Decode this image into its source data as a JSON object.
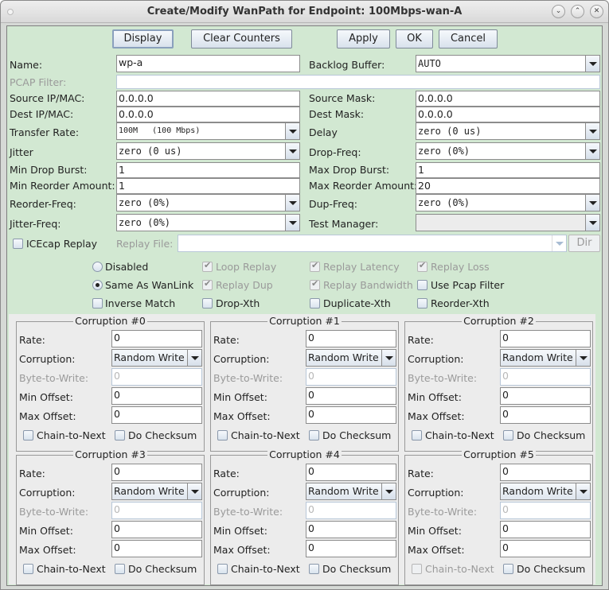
{
  "window": {
    "title": "Create/Modify WanPath for Endpoint: 100Mbps-wan-A",
    "controls": [
      "minimize",
      "maximize",
      "close"
    ]
  },
  "toolbar": {
    "display_label": "Display",
    "clear_counters_label": "Clear Counters",
    "apply_label": "Apply",
    "ok_label": "OK",
    "cancel_label": "Cancel"
  },
  "form": {
    "name_label": "Name:",
    "name_value": "wp-a",
    "backlog_label": "Backlog Buffer:",
    "backlog_value": "AUTO",
    "pcap_label": "PCAP Filter:",
    "pcap_value": "",
    "src_ip_label": "Source IP/MAC:",
    "src_ip_value": "0.0.0.0",
    "src_mask_label": "Source Mask:",
    "src_mask_value": "0.0.0.0",
    "dst_ip_label": "Dest IP/MAC:",
    "dst_ip_value": "0.0.0.0",
    "dst_mask_label": "Dest Mask:",
    "dst_mask_value": "0.0.0.0",
    "rate_label": "Transfer Rate:",
    "rate_value": "100M   (100 Mbps)",
    "delay_label": "Delay",
    "delay_value": "zero (0 us)",
    "jitter_label": "Jitter",
    "jitter_value": "zero (0 us)",
    "drop_freq_label": "Drop-Freq:",
    "drop_freq_value": "zero (0%)",
    "min_drop_label": "Min Drop Burst:",
    "min_drop_value": "1",
    "max_drop_label": "Max Drop Burst:",
    "max_drop_value": "1",
    "min_reorder_label": "Min Reorder Amount:",
    "min_reorder_value": "1",
    "max_reorder_label": "Max Reorder Amount:",
    "max_reorder_value": "20",
    "reorder_freq_label": "Reorder-Freq:",
    "reorder_freq_value": "zero (0%)",
    "dup_freq_label": "Dup-Freq:",
    "dup_freq_value": "zero (0%)",
    "jitter_freq_label": "Jitter-Freq:",
    "jitter_freq_value": "zero (0%)",
    "test_mgr_label": "Test Manager:",
    "test_mgr_value": "",
    "icecap_label": "ICEcap Replay",
    "replay_file_label": "Replay File:",
    "replay_file_value": "",
    "dir_label": "Dir"
  },
  "options": {
    "disabled_label": "Disabled",
    "same_as_wanlink_label": "Same As WanLink",
    "inverse_match_label": "Inverse Match",
    "loop_replay_label": "Loop Replay",
    "replay_dup_label": "Replay Dup",
    "drop_xth_label": "Drop-Xth",
    "replay_latency_label": "Replay Latency",
    "replay_bandwidth_label": "Replay Bandwidth",
    "duplicate_xth_label": "Duplicate-Xth",
    "replay_loss_label": "Replay Loss",
    "use_pcap_filter_label": "Use Pcap Filter",
    "reorder_xth_label": "Reorder-Xth",
    "selected_mode": "Same As WanLink"
  },
  "corruption_labels": {
    "rate": "Rate:",
    "corruption": "Corruption:",
    "byte_to_write": "Byte-to-Write:",
    "min_offset": "Min Offset:",
    "max_offset": "Max Offset:",
    "chain": "Chain-to-Next",
    "checksum": "Do Checksum"
  },
  "corruptions": [
    {
      "title": "Corruption #0",
      "rate": "0",
      "type": "Random Write",
      "byte": "0",
      "min": "0",
      "max": "0"
    },
    {
      "title": "Corruption #1",
      "rate": "0",
      "type": "Random Write",
      "byte": "0",
      "min": "0",
      "max": "0"
    },
    {
      "title": "Corruption #2",
      "rate": "0",
      "type": "Random Write",
      "byte": "0",
      "min": "0",
      "max": "0"
    },
    {
      "title": "Corruption #3",
      "rate": "0",
      "type": "Random Write",
      "byte": "0",
      "min": "0",
      "max": "0"
    },
    {
      "title": "Corruption #4",
      "rate": "0",
      "type": "Random Write",
      "byte": "0",
      "min": "0",
      "max": "0"
    },
    {
      "title": "Corruption #5",
      "rate": "0",
      "type": "Random Write",
      "byte": "0",
      "min": "0",
      "max": "0"
    }
  ]
}
